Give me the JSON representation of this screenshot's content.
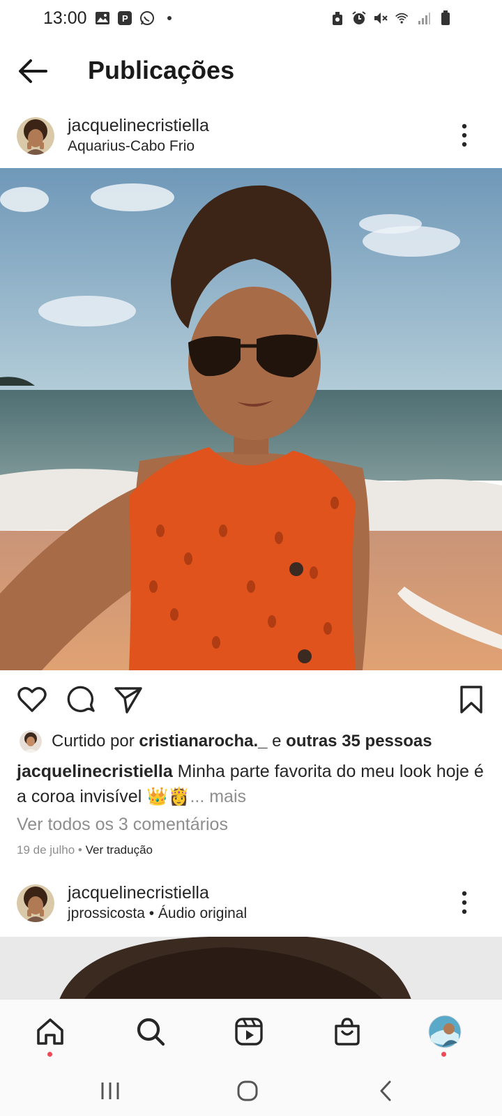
{
  "status_bar": {
    "time": "13:00",
    "left_icons": [
      "gallery-icon",
      "p-app-icon",
      "whatsapp-icon",
      "dot-icon"
    ],
    "right_icons": [
      "recycle-icon",
      "alarm-icon",
      "mute-icon",
      "wifi-icon",
      "signal-icon",
      "battery-icon"
    ]
  },
  "header": {
    "title": "Publicações",
    "back_icon": "arrow-left-icon"
  },
  "post1": {
    "username": "jacquelinecristiella",
    "location": "Aquarius-Cabo Frio",
    "liked_by_prefix": "Curtido por ",
    "liked_by_user": "cristianarocha._",
    "liked_by_joiner": " e ",
    "liked_by_others": "outras 35 pessoas",
    "caption_user": "jacquelinecristiella",
    "caption_text": " Minha parte favorita do meu look hoje é a coroa invisível 👑👸",
    "caption_more": "... mais",
    "view_comments": "Ver todos os 3 comentários",
    "date": "19 de julho",
    "separator": " • ",
    "translate": "Ver tradução"
  },
  "post2": {
    "username": "jacquelinecristiella",
    "subtitle": "jprossicosta • Áudio original"
  },
  "bottom_nav": {
    "items": [
      "home-icon",
      "search-icon",
      "reels-icon",
      "shop-icon",
      "profile-avatar"
    ]
  },
  "system_nav": {
    "items": [
      "recents-icon",
      "home-circle-icon",
      "back-chevron-icon"
    ]
  },
  "colors": {
    "notification_dot": "#ed4956",
    "secondary_text": "#8e8e8e",
    "primary_text": "#262626"
  }
}
